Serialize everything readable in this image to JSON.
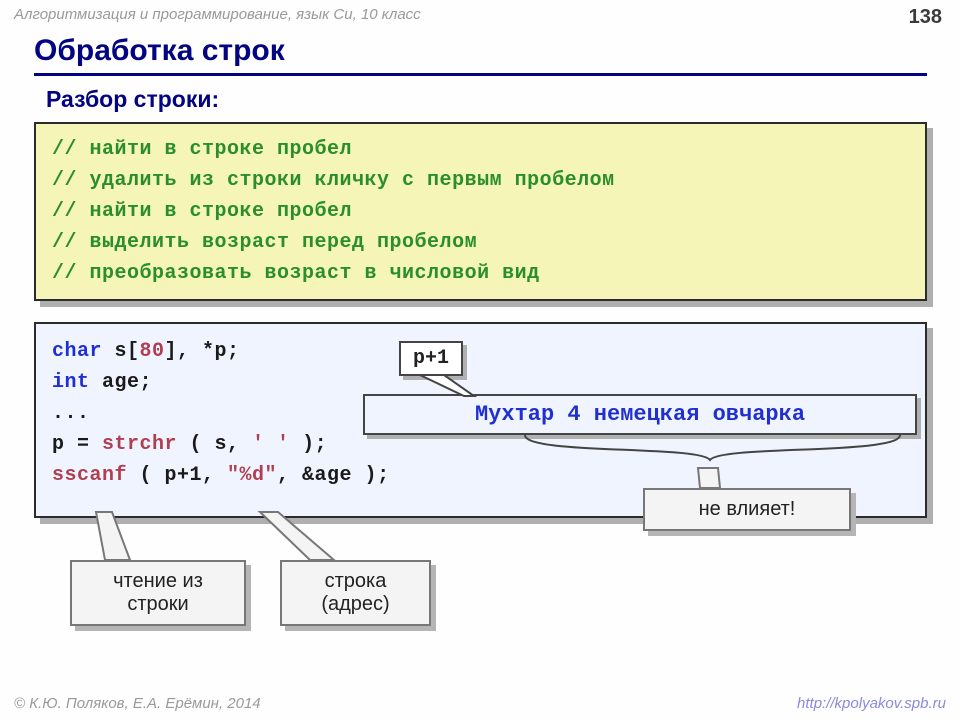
{
  "header": {
    "course": "Алгоритмизация и программирование, язык Си, 10 класс",
    "page": "138"
  },
  "title": "Обработка строк",
  "subtitle": "Разбор строки:",
  "comments": [
    "// найти в строке пробел",
    "// удалить из строки кличку с первым пробелом",
    "// найти в строке пробел",
    "// выделить возраст перед пробелом",
    "// преобразовать возраст в числовой вид"
  ],
  "code": {
    "l1a": "char",
    "l1b": " s[",
    "l1c": "80",
    "l1d": "], *p;",
    "l2a": "int",
    "l2b": " age;",
    "l3": "...",
    "l4a": "p = ",
    "l4b": "strchr",
    "l4c": " ( s, ",
    "l4d": "' '",
    "l4e": " );",
    "l5a": "sscanf",
    "l5b": " ( p+1, ",
    "l5c": "\"%d\"",
    "l5d": ", &age );"
  },
  "ann": {
    "p1": "p+1",
    "example": "Мухтар 4 немецкая овчарка",
    "no_effect": "не влияет!",
    "read": "чтение из\nстроки",
    "addr": "строка\n(адрес)"
  },
  "footer": {
    "left": "© К.Ю. Поляков, Е.А. Ерёмин, 2014",
    "right": "http://kpolyakov.spb.ru"
  }
}
